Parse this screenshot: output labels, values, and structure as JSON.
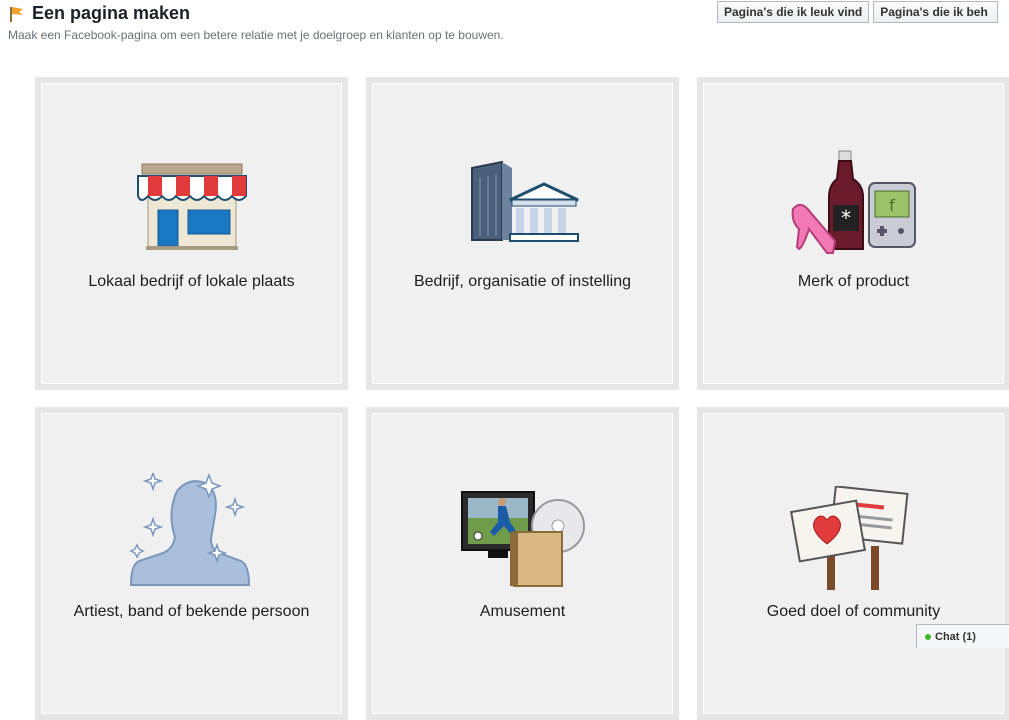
{
  "header": {
    "title": "Een pagina maken",
    "subtitle": "Maak een Facebook-pagina om een betere relatie met je doelgroep en klanten op te bouwen."
  },
  "top_buttons": [
    {
      "label": "Pagina's die ik leuk vind"
    },
    {
      "label": "Pagina's die ik beh"
    }
  ],
  "categories": [
    {
      "label": "Lokaal bedrijf of lokale plaats",
      "icon": "storefront-icon"
    },
    {
      "label": "Bedrijf, organisatie of instelling",
      "icon": "buildings-icon"
    },
    {
      "label": "Merk of product",
      "icon": "products-icon"
    },
    {
      "label": "Artiest, band of bekende persoon",
      "icon": "person-silhouette-icon"
    },
    {
      "label": "Amusement",
      "icon": "entertainment-icon"
    },
    {
      "label": "Goed doel of community",
      "icon": "protest-signs-icon"
    }
  ],
  "chat": {
    "label": "Chat (1)"
  },
  "colors": {
    "accent_red": "#e23b3b",
    "accent_blue": "#1a78c2"
  }
}
